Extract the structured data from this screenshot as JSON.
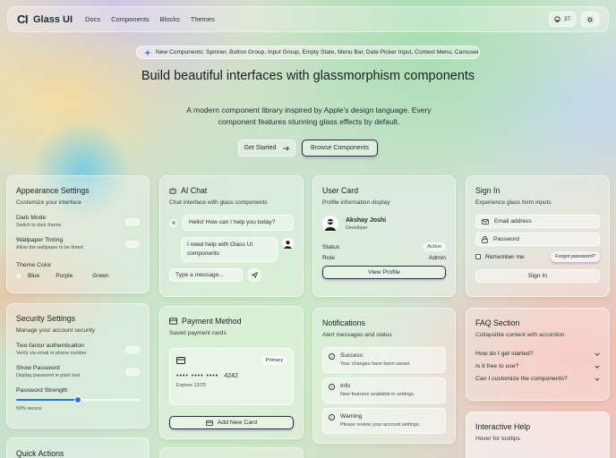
{
  "nav": {
    "logo_mark": "CI",
    "logo_text": "Glass UI",
    "links": [
      "Docs",
      "Components",
      "Blocks",
      "Themes"
    ],
    "stars": "37",
    "icons": {
      "github": "github-icon",
      "theme": "sun-icon"
    }
  },
  "banner": {
    "text": "New Components: Spinner, Button Group, Input Group, Empty State, Menu Bar, Date Picker Input, Context Menu, Carousel"
  },
  "hero": {
    "title": "Build beautiful interfaces with glassmorphism components",
    "subtitle": "A modern component library inspired by Apple's design language. Every component features stunning glass effects by default.",
    "get_started": "Get Started",
    "browse": "Browse Components"
  },
  "appearance": {
    "title": "Appearance Settings",
    "subtitle": "Customize your interface",
    "dark_mode": {
      "label": "Dark Mode",
      "desc": "Switch to dark theme"
    },
    "wallpaper": {
      "label": "Wallpaper Tinting",
      "desc": "Allow the wallpaper to be tinted"
    },
    "theme_color": {
      "label": "Theme Color",
      "options": [
        "Blue",
        "Purple",
        "Green"
      ]
    }
  },
  "security": {
    "title": "Security Settings",
    "subtitle": "Manage your account security",
    "twofa": {
      "label": "Two-factor authentication",
      "desc": "Verify via email or phone number"
    },
    "show_password": {
      "label": "Show Password",
      "desc": "Display password in plain text"
    },
    "strength": {
      "label": "Password Strength",
      "value": 0.5,
      "text": "50% secure"
    }
  },
  "quick_actions": {
    "title": "Quick Actions"
  },
  "chat": {
    "title": "AI Chat",
    "subtitle": "Chat interface with glass components",
    "msg_bot": "Hello! How can I help you today?",
    "msg_user": "I need help with Glass UI components",
    "placeholder": "Type a message..."
  },
  "payment": {
    "title": "Payment Method",
    "subtitle": "Saved payment cards",
    "badge": "Primary",
    "dots": "•••• •••• ••••",
    "last4": "4242",
    "expires": "Expires 12/25",
    "add_button": "Add New Card"
  },
  "user": {
    "title": "User Card",
    "subtitle": "Profile information display",
    "name": "Akshay Joshi",
    "role_title": "Developer",
    "status_label": "Status",
    "status_value": "Active",
    "role_label": "Role",
    "role_value": "Admin",
    "view_button": "View Profile"
  },
  "notifications": {
    "title": "Notifications",
    "subtitle": "Alert messages and status",
    "items": [
      {
        "title": "Success",
        "desc": "Your changes have been saved.",
        "icon": "check-circle-icon"
      },
      {
        "title": "Info",
        "desc": "New features available in settings.",
        "icon": "info-circle-icon"
      },
      {
        "title": "Warning",
        "desc": "Please review your account settings.",
        "icon": "warning-circle-icon"
      }
    ]
  },
  "signin": {
    "title": "Sign In",
    "subtitle": "Experience glass form inputs",
    "email_placeholder": "Email address",
    "password_placeholder": "Password",
    "remember": "Remember me",
    "forgot": "Forgot password?",
    "submit": "Sign In"
  },
  "faq": {
    "title": "FAQ Section",
    "subtitle": "Collapsible content with accordion",
    "items": [
      "How do I get started?",
      "Is it free to use?",
      "Can I customize the components?"
    ]
  },
  "help": {
    "title": "Interactive Help",
    "subtitle": "Hover for tooltips"
  },
  "colors": {
    "slider_blue": "#2f6fe0",
    "accent_purple": "#8c5ac8"
  }
}
